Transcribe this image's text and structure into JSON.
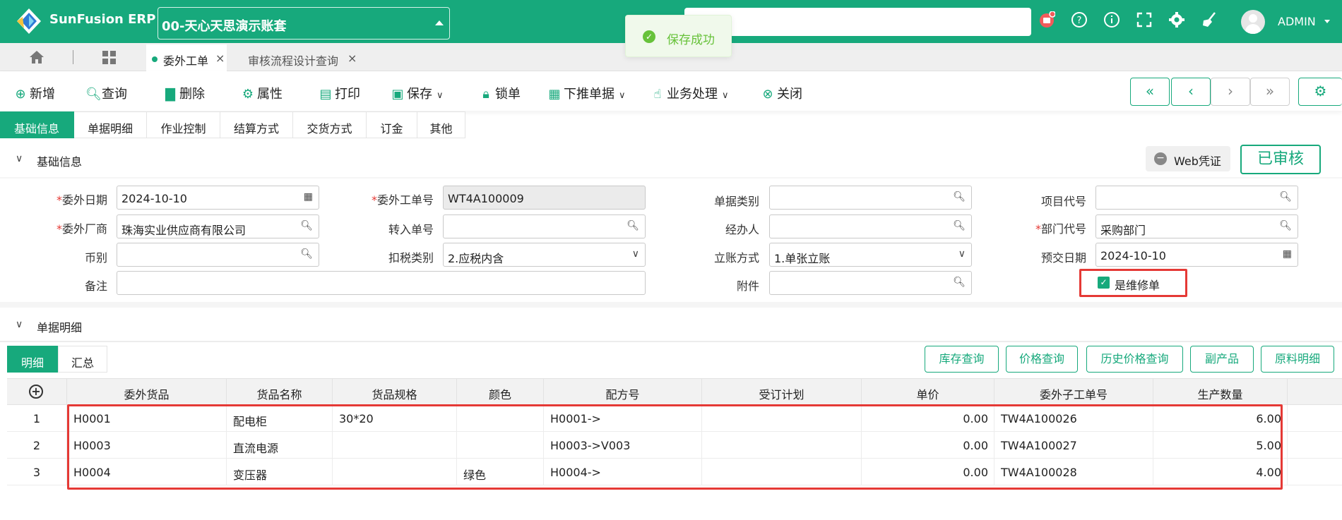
{
  "app": {
    "brand": "SunFusion ERP",
    "account": "00-天心天思演示账套",
    "user": "ADMIN"
  },
  "toast": {
    "text": "保存成功"
  },
  "tabs": {
    "home_icon": "home-icon",
    "grid_icon": "grid-icon",
    "items": [
      {
        "label": "委外工单"
      },
      {
        "label": "审核流程设计查询"
      }
    ]
  },
  "toolbar": {
    "new": "新增",
    "query": "查询",
    "delete": "删除",
    "props": "属性",
    "print": "打印",
    "save": "保存",
    "lock": "锁单",
    "push": "下推单据",
    "business": "业务处理",
    "close": "关闭"
  },
  "form_tabs": [
    "基础信息",
    "单据明细",
    "作业控制",
    "结算方式",
    "交货方式",
    "订金",
    "其他"
  ],
  "section1": {
    "title": "基础信息",
    "web_voucher": "Web凭证",
    "status": "已审核"
  },
  "form": {
    "outsource_date_label": "委外日期",
    "outsource_date": "2024-10-10",
    "outsource_no_label": "委外工单号",
    "outsource_no": "WT4A100009",
    "bill_type_label": "单据类别",
    "bill_type": "",
    "project_label": "项目代号",
    "project": "",
    "vendor_label": "委外厂商",
    "vendor": "珠海实业供应商有限公司",
    "transfer_no_label": "转入单号",
    "transfer_no": "",
    "handler_label": "经办人",
    "handler": "",
    "dept_label": "部门代号",
    "dept": "采购部门",
    "currency_label": "币别",
    "currency": "",
    "tax_type_label": "扣税类别",
    "tax_type": "2.应税内含",
    "account_mode_label": "立账方式",
    "account_mode": "1.单张立账",
    "delivery_date_label": "预交日期",
    "delivery_date": "2024-10-10",
    "remark_label": "备注",
    "remark": "",
    "attach_label": "附件",
    "attach": "",
    "repair_label": "是维修单",
    "repair_checked": true
  },
  "section2": {
    "title": "单据明细"
  },
  "detail_tabs": [
    "明细",
    "汇总"
  ],
  "detail_buttons": [
    "库存查询",
    "价格查询",
    "历史价格查询",
    "副产品",
    "原料明细"
  ],
  "table": {
    "columns": [
      "委外货品",
      "货品名称",
      "货品规格",
      "颜色",
      "配方号",
      "受订计划",
      "单价",
      "委外子工单号",
      "生产数量"
    ],
    "rows": [
      {
        "idx": "1",
        "item": "H0001",
        "name": "配电柜",
        "spec": "30*20",
        "color": "",
        "formula": "H0001->",
        "plan": "",
        "price": "0.00",
        "sub_no": "TW4A100026",
        "qty": "6.00"
      },
      {
        "idx": "2",
        "item": "H0003",
        "name": "直流电源",
        "spec": "",
        "color": "",
        "formula": "H0003->V003",
        "plan": "",
        "price": "0.00",
        "sub_no": "TW4A100027",
        "qty": "5.00"
      },
      {
        "idx": "3",
        "item": "H0004",
        "name": "变压器",
        "spec": "",
        "color": "绿色",
        "formula": "H0004->",
        "plan": "",
        "price": "0.00",
        "sub_no": "TW4A100028",
        "qty": "4.00"
      }
    ]
  },
  "colors": {
    "accent": "#17a97c",
    "highlight": "#e53935",
    "toast_bg": "#f0f9eb",
    "toast_text": "#67c23a"
  }
}
